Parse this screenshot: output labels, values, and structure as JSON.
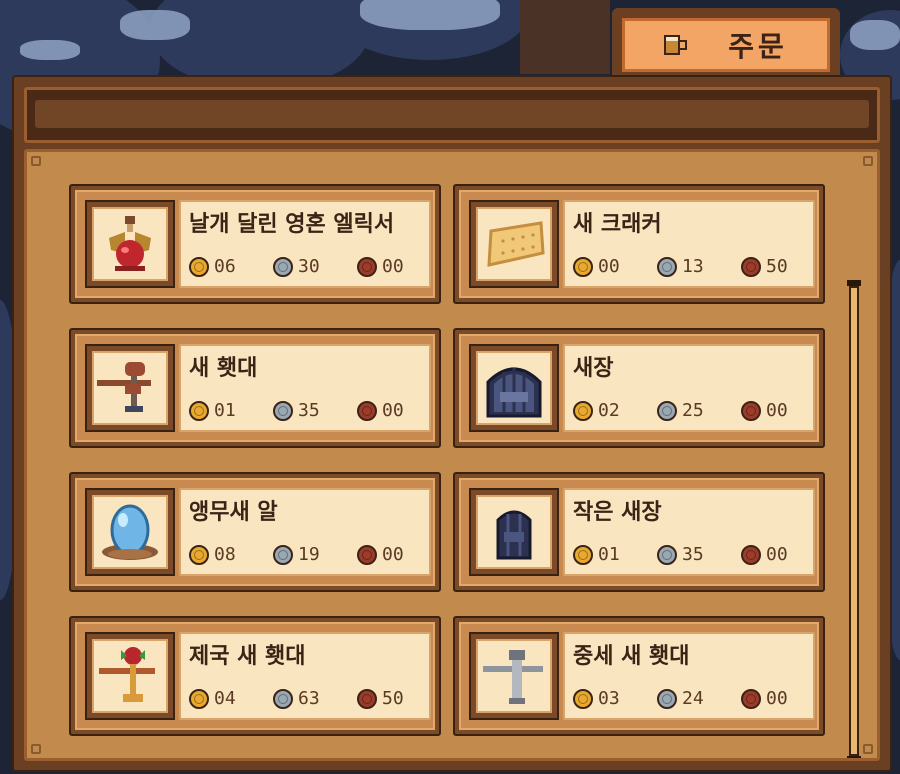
{
  "tab": {
    "label": "주문",
    "icon": "beer-mug-icon"
  },
  "header": {
    "text": ""
  },
  "coins": {
    "gold": "#e8a92e",
    "silver": "#9aa7b5",
    "copper": "#9c3b2b"
  },
  "items": [
    {
      "name": "날개 달린 영혼 엘릭서",
      "icon": "winged-soul-elixir-icon",
      "gold": "06",
      "silver": "30",
      "copper": "00"
    },
    {
      "name": "새 크래커",
      "icon": "bird-cracker-icon",
      "gold": "00",
      "silver": "13",
      "copper": "50"
    },
    {
      "name": "새 횃대",
      "icon": "bird-perch-icon",
      "gold": "01",
      "silver": "35",
      "copper": "00"
    },
    {
      "name": "새장",
      "icon": "birdcage-icon",
      "gold": "02",
      "silver": "25",
      "copper": "00"
    },
    {
      "name": "앵무새 알",
      "icon": "parrot-egg-icon",
      "gold": "08",
      "silver": "19",
      "copper": "00"
    },
    {
      "name": "작은 새장",
      "icon": "small-birdcage-icon",
      "gold": "01",
      "silver": "35",
      "copper": "00"
    },
    {
      "name": "제국 새 횃대",
      "icon": "imperial-bird-perch-icon",
      "gold": "04",
      "silver": "63",
      "copper": "50"
    },
    {
      "name": "중세 새 횃대",
      "icon": "medieval-bird-perch-icon",
      "gold": "03",
      "silver": "24",
      "copper": "00"
    }
  ]
}
